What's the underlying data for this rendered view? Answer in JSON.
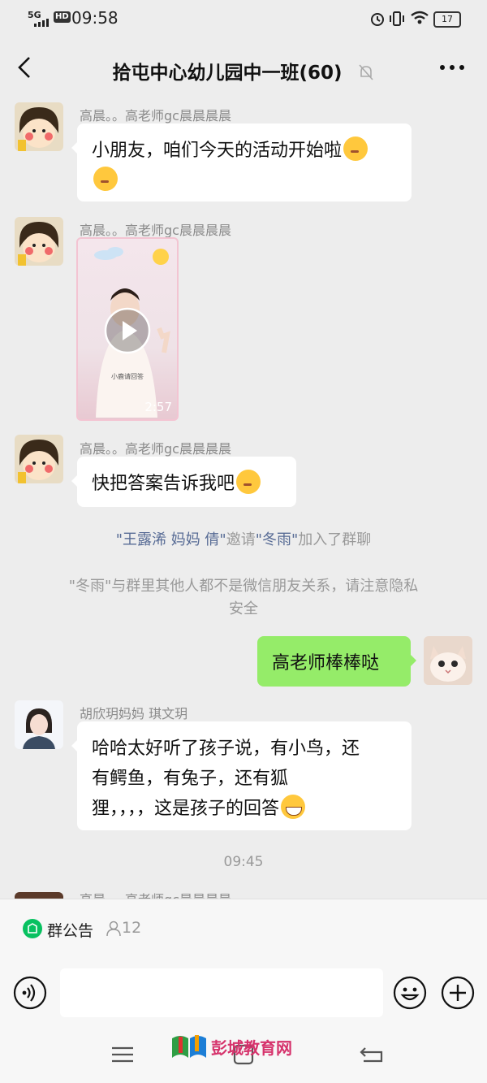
{
  "status_bar": {
    "network": "5G",
    "hd_badge": "HD",
    "time": "09:58",
    "battery": "17"
  },
  "nav": {
    "title": "拾屯中心幼儿园中一班(60)"
  },
  "messages": [
    {
      "sender": "高晨。。高老师gc晨晨晨晨",
      "text": "小朋友，咱们今天的活动开始啦"
    },
    {
      "sender": "高晨。。高老师gc晨晨晨晨",
      "video_duration": "2:57",
      "video_caption": "小鹿请回答"
    },
    {
      "sender": "高晨。。高老师gc晨晨晨晨",
      "text": "快把答案告诉我吧"
    },
    {
      "system": {
        "invitee_names": "\"王露浠   妈妈 倩\"",
        "invite_word": "邀请",
        "invited_name": "\"冬雨\"",
        "joined_text": "加入了群聊"
      }
    },
    {
      "system_notice_line1": "\"冬雨\"与群里其他人都不是微信朋友关系，请注意隐私",
      "system_notice_line2": "安全"
    },
    {
      "me": true,
      "text": "高老师棒棒哒"
    },
    {
      "sender": "胡欣玥妈妈   琪文玥",
      "text_line1": "哈哈太好听了孩子说，有小鸟，还",
      "text_line2": "有鳄鱼，有兔子，还有狐",
      "text_line3": "狸，，，，这是孩子的回答"
    },
    {
      "timestamp": "09:45"
    },
    {
      "sender": "高晨。。高老师gc晨晨晨晨"
    }
  ],
  "announcement": {
    "label": "群公告",
    "count": "12"
  },
  "watermark": "彭城教育网",
  "colors": {
    "my_bubble": "#95ec69",
    "chat_bg": "#ededed",
    "system_name": "#576b95",
    "announce_icon": "#07c160"
  }
}
